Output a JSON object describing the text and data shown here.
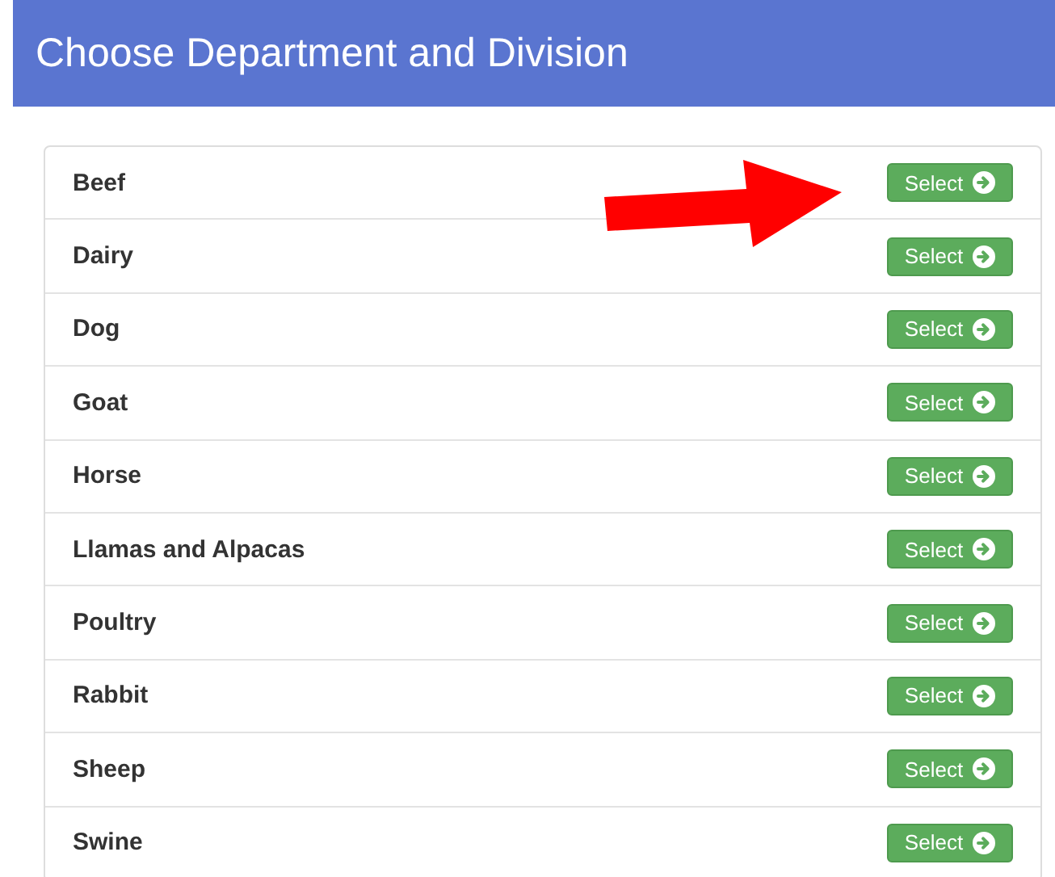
{
  "header": {
    "title": "Choose Department and Division"
  },
  "departments": [
    {
      "name": "Beef",
      "button": "Select"
    },
    {
      "name": "Dairy",
      "button": "Select"
    },
    {
      "name": "Dog",
      "button": "Select"
    },
    {
      "name": "Goat",
      "button": "Select"
    },
    {
      "name": "Horse",
      "button": "Select"
    },
    {
      "name": "Llamas and Alpacas",
      "button": "Select"
    },
    {
      "name": "Poultry",
      "button": "Select"
    },
    {
      "name": "Rabbit",
      "button": "Select"
    },
    {
      "name": "Sheep",
      "button": "Select"
    },
    {
      "name": "Swine",
      "button": "Select"
    }
  ]
}
